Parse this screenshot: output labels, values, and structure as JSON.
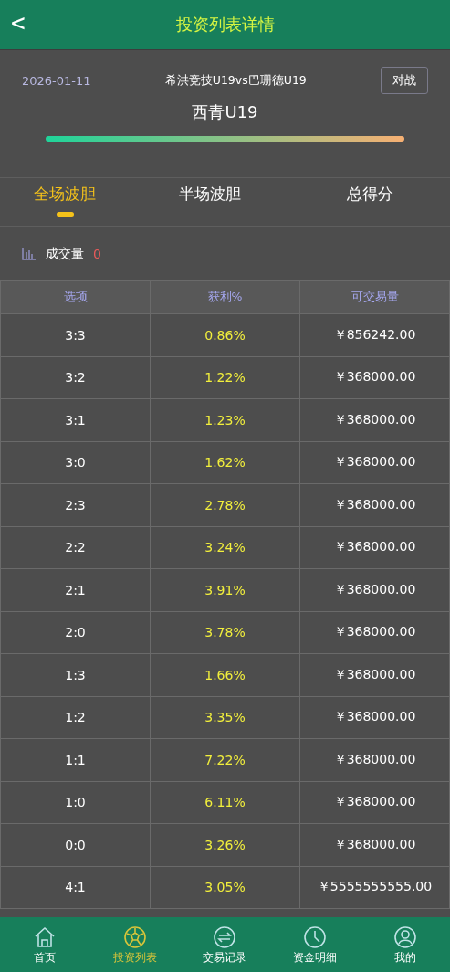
{
  "header": {
    "back": "<",
    "title": "投资列表详情"
  },
  "match": {
    "date": "2026-01-11",
    "teams": "希洪竞技U19vs巴珊德U19",
    "button": "对战",
    "team": "西青U19"
  },
  "tabs": [
    {
      "label": "全场波胆",
      "selected": true
    },
    {
      "label": "半场波胆",
      "selected": false
    },
    {
      "label": "总得分",
      "selected": false
    }
  ],
  "volume": {
    "label": "成交量",
    "value": "0"
  },
  "table": {
    "columns": [
      "选项",
      "获利%",
      "可交易量"
    ],
    "rows": [
      [
        "3:3",
        "0.86%",
        "￥856242.00"
      ],
      [
        "3:2",
        "1.22%",
        "￥368000.00"
      ],
      [
        "3:1",
        "1.23%",
        "￥368000.00"
      ],
      [
        "3:0",
        "1.62%",
        "￥368000.00"
      ],
      [
        "2:3",
        "2.78%",
        "￥368000.00"
      ],
      [
        "2:2",
        "3.24%",
        "￥368000.00"
      ],
      [
        "2:1",
        "3.91%",
        "￥368000.00"
      ],
      [
        "2:0",
        "3.78%",
        "￥368000.00"
      ],
      [
        "1:3",
        "1.66%",
        "￥368000.00"
      ],
      [
        "1:2",
        "3.35%",
        "￥368000.00"
      ],
      [
        "1:1",
        "7.22%",
        "￥368000.00"
      ],
      [
        "1:0",
        "6.11%",
        "￥368000.00"
      ],
      [
        "0:0",
        "3.26%",
        "￥368000.00"
      ],
      [
        "4:1",
        "3.05%",
        "￥5555555555.00"
      ]
    ]
  },
  "nav": [
    {
      "label": "首页",
      "kind": "home",
      "selected": false
    },
    {
      "label": "投资列表",
      "kind": "ball",
      "selected": true
    },
    {
      "label": "交易记录",
      "kind": "swap",
      "selected": false
    },
    {
      "label": "资金明细",
      "kind": "clock",
      "selected": false
    },
    {
      "label": "我的",
      "kind": "user",
      "selected": false
    }
  ]
}
